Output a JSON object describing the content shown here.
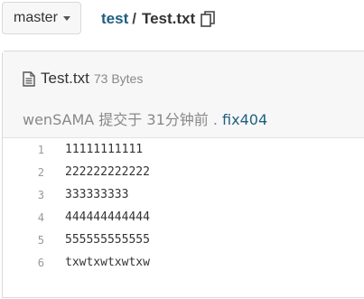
{
  "branch": {
    "label": "master"
  },
  "breadcrumb": {
    "repo": "test",
    "separator": "/",
    "file": "Test.txt"
  },
  "file": {
    "name": "Test.txt",
    "size": "73 Bytes",
    "commit_author_time": "wenSAMA 提交于 31分钟前 .",
    "commit_message": "fix404"
  },
  "code": {
    "lines": [
      {
        "num": "1",
        "text": "11111111111"
      },
      {
        "num": "2",
        "text": "222222222222"
      },
      {
        "num": "3",
        "text": "333333333"
      },
      {
        "num": "4",
        "text": "444444444444"
      },
      {
        "num": "5",
        "text": "555555555555"
      },
      {
        "num": "6",
        "text": "txwtxwtxwtxw"
      }
    ]
  },
  "colors": {
    "link": "#1f5f80",
    "muted": "#888888",
    "header_bg": "#f7f7f7"
  },
  "icons": {
    "copy": "copy-icon",
    "file": "file-text-icon",
    "dropdown": "caret-down-icon"
  }
}
